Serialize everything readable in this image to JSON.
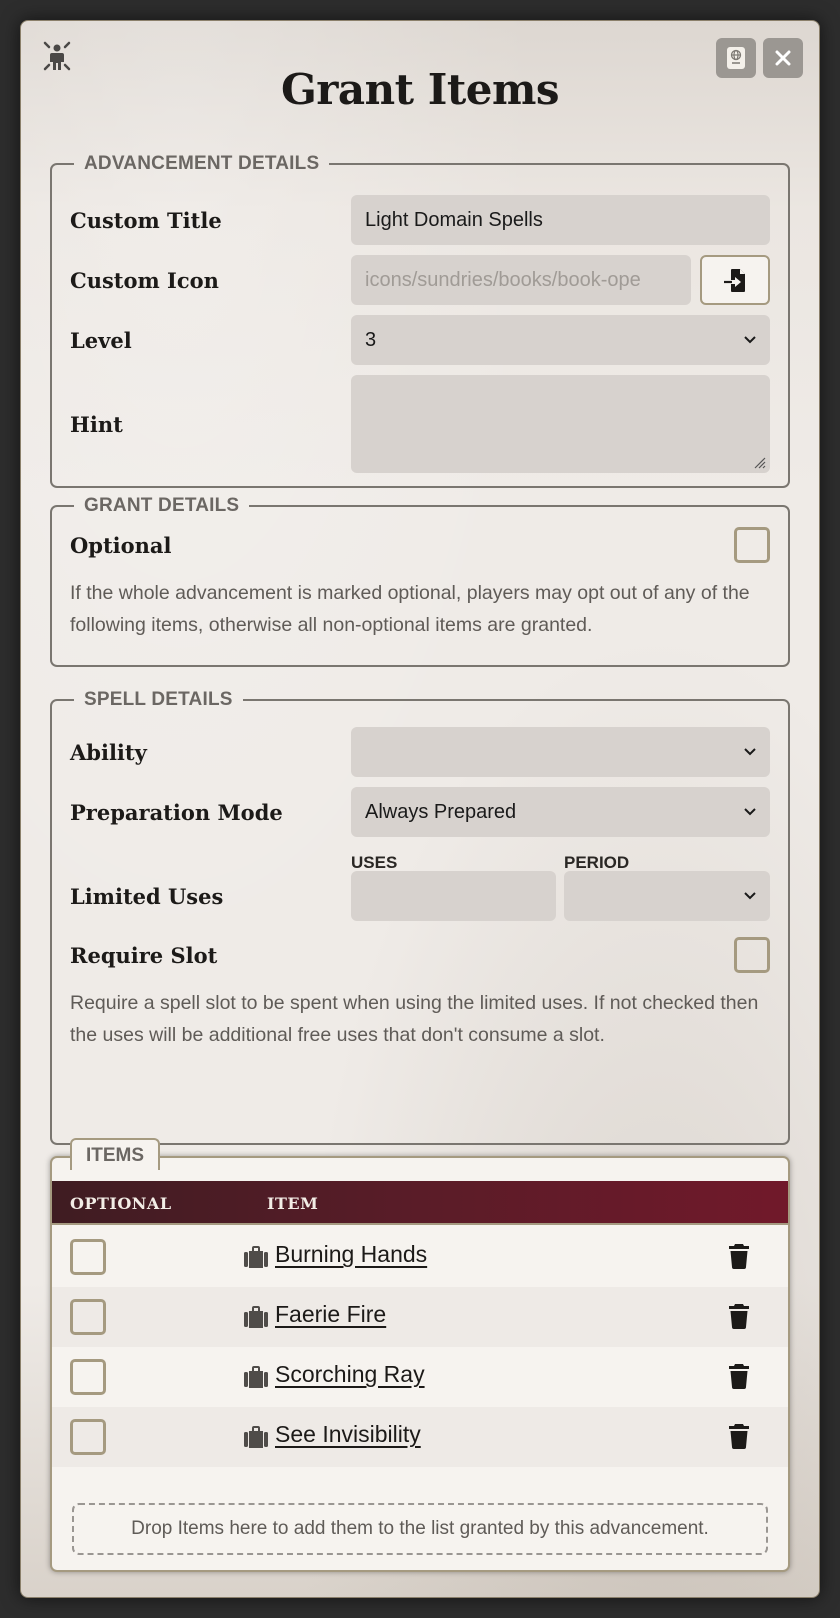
{
  "window": {
    "title": "Grant Items",
    "header_icon": "advancement-person-icon",
    "buttons": [
      {
        "name": "compendium-browser-button",
        "icon": "passport-globe-icon"
      },
      {
        "name": "close-button",
        "icon": "close-icon"
      }
    ]
  },
  "advancement_details": {
    "legend": "ADVANCEMENT DETAILS",
    "custom_title": {
      "label": "Custom Title",
      "value": "Light Domain Spells"
    },
    "custom_icon": {
      "label": "Custom Icon",
      "placeholder": "icons/sundries/books/book-ope",
      "button_icon": "file-import-icon"
    },
    "level": {
      "label": "Level",
      "value": "3"
    },
    "hint": {
      "label": "Hint",
      "value": ""
    }
  },
  "grant_details": {
    "legend": "GRANT DETAILS",
    "optional": {
      "label": "Optional",
      "checked": false
    },
    "hint": "If the whole advancement is marked optional, players may opt out of any of the following items, otherwise all non-optional items are granted."
  },
  "spell_details": {
    "legend": "SPELL DETAILS",
    "ability": {
      "label": "Ability",
      "value": ""
    },
    "preparation_mode": {
      "label": "Preparation Mode",
      "value": "Always Prepared"
    },
    "limited_uses": {
      "label": "Limited Uses",
      "uses_label": "USES",
      "uses_value": "",
      "period_label": "PERIOD",
      "period_value": ""
    },
    "require_slot": {
      "label": "Require Slot",
      "checked": false
    },
    "hint": "Require a spell slot to be spent when using the limited uses. If not checked then the uses will be additional free uses that don't consume a slot."
  },
  "items": {
    "tab_label": "ITEMS",
    "columns": [
      "OPTIONAL",
      "ITEM"
    ],
    "rows": [
      {
        "name": "Burning Hands",
        "optional": false
      },
      {
        "name": "Faerie Fire",
        "optional": false
      },
      {
        "name": "Scorching Ray",
        "optional": false
      },
      {
        "name": "See Invisibility",
        "optional": false
      }
    ],
    "dropzone_text": "Drop Items here to add them to the list granted by this advancement."
  },
  "colors": {
    "header_gradient_start": "#3f1c22",
    "header_gradient_end": "#71192a",
    "checkbox_border": "#a59a80"
  }
}
